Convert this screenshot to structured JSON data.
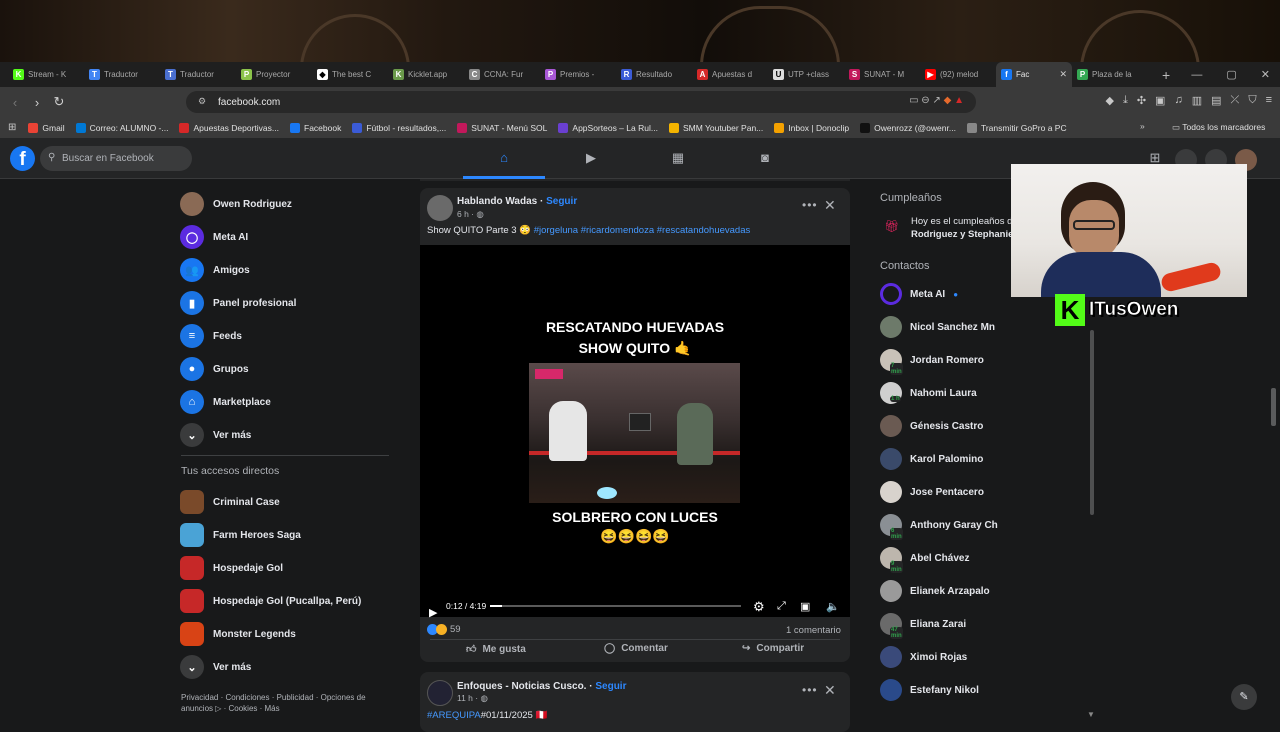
{
  "browser": {
    "tabs": [
      {
        "label": "Stream - K",
        "color": "#53fc18",
        "glyph": "K"
      },
      {
        "label": "Traductor",
        "color": "#4285f4",
        "glyph": "T"
      },
      {
        "label": "Traductor",
        "color": "#4a6fd0",
        "glyph": "T"
      },
      {
        "label": "Proyector",
        "color": "#8bc34a",
        "glyph": "P"
      },
      {
        "label": "The best C",
        "color": "#ffffff",
        "glyph": "◆"
      },
      {
        "label": "Kicklet.app",
        "color": "#6a9a4a",
        "glyph": "K"
      },
      {
        "label": "CCNA: Fur",
        "color": "#888888",
        "glyph": "C"
      },
      {
        "label": "Premios -",
        "color": "#a857d6",
        "glyph": "P"
      },
      {
        "label": "Resultado",
        "color": "#3b5bd6",
        "glyph": "R"
      },
      {
        "label": "Apuestas d",
        "color": "#d62828",
        "glyph": "A"
      },
      {
        "label": "UTP +class",
        "color": "#dddddd",
        "glyph": "U"
      },
      {
        "label": "SUNAT - M",
        "color": "#c2185b",
        "glyph": "S"
      },
      {
        "label": "(92) melod",
        "color": "#ff0000",
        "glyph": "▶"
      },
      {
        "label": "Fac",
        "color": "#1877f2",
        "glyph": "f",
        "active": true
      },
      {
        "label": "Plaza de la",
        "color": "#34a853",
        "glyph": "P"
      }
    ],
    "new_tab": "+",
    "window_controls": [
      "—",
      "▢",
      "✕"
    ],
    "url": "facebook.com",
    "bookmarks": [
      {
        "label": "Gmail",
        "color": "#ea4335"
      },
      {
        "label": "Correo: ALUMNO -...",
        "color": "#0078d4"
      },
      {
        "label": "Apuestas Deportivas...",
        "color": "#d62828"
      },
      {
        "label": "Facebook",
        "color": "#1877f2"
      },
      {
        "label": "Fútbol - resultados,...",
        "color": "#3b5bd6"
      },
      {
        "label": "SUNAT - Menú SOL",
        "color": "#c2185b"
      },
      {
        "label": "AppSorteos – La Rul...",
        "color": "#6a3fd0"
      },
      {
        "label": "SMM Youtuber Pan...",
        "color": "#f4b400"
      },
      {
        "label": "Inbox | Donoclip",
        "color": "#f4a100"
      },
      {
        "label": "Owenrozz (@owenr...",
        "color": "#111111"
      },
      {
        "label": "Transmitir GoPro a PC",
        "color": "#888888"
      }
    ],
    "bookmarks_more": "»",
    "all_bookmarks": "Todos los marcadores"
  },
  "fb": {
    "search_placeholder": "Buscar en Facebook",
    "left_nav": [
      {
        "label": "Owen Rodriguez",
        "color": "#8a6a55",
        "glyph": ""
      },
      {
        "label": "Meta AI",
        "color": "#5b2be0",
        "glyph": "◯"
      },
      {
        "label": "Amigos",
        "color": "#1877f2",
        "glyph": "👥"
      },
      {
        "label": "Panel profesional",
        "color": "#1b74e4",
        "glyph": "▮"
      },
      {
        "label": "Feeds",
        "color": "#1b74e4",
        "glyph": "≡"
      },
      {
        "label": "Grupos",
        "color": "#1b74e4",
        "glyph": "●"
      },
      {
        "label": "Marketplace",
        "color": "#1b74e4",
        "glyph": "⌂"
      },
      {
        "label": "Ver más",
        "color": "#3a3b3c",
        "glyph": "⌄"
      }
    ],
    "shortcuts_title": "Tus accesos directos",
    "shortcuts": [
      {
        "label": "Criminal Case",
        "color": "#7a4a2a"
      },
      {
        "label": "Farm Heroes Saga",
        "color": "#4aa3d6"
      },
      {
        "label": "Hospedaje Gol",
        "color": "#c62828"
      },
      {
        "label": "Hospedaje Gol (Pucallpa, Perú)",
        "color": "#c62828"
      },
      {
        "label": "Monster Legends",
        "color": "#d84315"
      },
      {
        "label": "Ver más",
        "color": "#3a3b3c"
      }
    ],
    "legal": "Privacidad · Condiciones · Publicidad · Opciones de anuncios ▷ · Cookies · Más",
    "post": {
      "author": "Hablando Wadas",
      "follow": "Seguir",
      "time": "6 h ·",
      "caption": "Show QUITO Parte 3 😳",
      "hashtags": "#jorgeluna #ricardomendoza #rescatandohuevadas",
      "video_title_1": "RESCATANDO HUEVADAS",
      "video_title_2": "SHOW QUITO 🤙",
      "video_subtitle": "SOLBRERO CON LUCES",
      "video_emojis": "😆😆😆😆",
      "time_display": "0:12 / 4:19",
      "progress": 0.046,
      "reaction_count": "59",
      "comments": "1 comentario",
      "like": "Me gusta",
      "comment": "Comentar",
      "share": "Compartir"
    },
    "post2": {
      "author": "Enfoques - Noticias Cusco.",
      "follow": "Seguir",
      "time": "11 h ·",
      "caption_tag": "#AREQUIPA",
      "caption": "#01/11/2025 🇵🇪"
    },
    "birthdays_title": "Cumpleaños",
    "birthday_text_1": "Hoy es el cumpleaños d",
    "birthday_text_2": "Rodriguez y Stephanie",
    "contacts_title": "Contactos",
    "contacts": [
      {
        "name": "Meta AI",
        "color": "#5b2be0",
        "badge": ""
      },
      {
        "name": "Nicol Sanchez Mn",
        "color": "#6d7a6a",
        "badge": ""
      },
      {
        "name": "Jordan Romero",
        "color": "#c9c2b8",
        "badge": "7 min"
      },
      {
        "name": "Nahomi Laura",
        "color": "#cfcfcf",
        "badge": "1 h"
      },
      {
        "name": "Génesis Castro",
        "color": "#6a5a52",
        "badge": ""
      },
      {
        "name": "Karol Palomino",
        "color": "#3a4a6a",
        "badge": ""
      },
      {
        "name": "Jose Pentacero",
        "color": "#d8d3cd",
        "badge": ""
      },
      {
        "name": "Anthony Garay Ch",
        "color": "#8a8f94",
        "badge": "6 min"
      },
      {
        "name": "Abel Chávez",
        "color": "#bdb6ad",
        "badge": "9 min"
      },
      {
        "name": "Elianek Arzapalo",
        "color": "#9a9a9a",
        "badge": ""
      },
      {
        "name": "Eliana Zarai",
        "color": "#6a6a6a",
        "badge": "47 min"
      },
      {
        "name": "Ximoi Rojas",
        "color": "#3a4a7a",
        "badge": ""
      },
      {
        "name": "Estefany Nikol",
        "color": "#2a4a8a",
        "badge": ""
      }
    ]
  },
  "stream": {
    "streamer_name": "ITusOwen",
    "kick_glyph": "K"
  }
}
